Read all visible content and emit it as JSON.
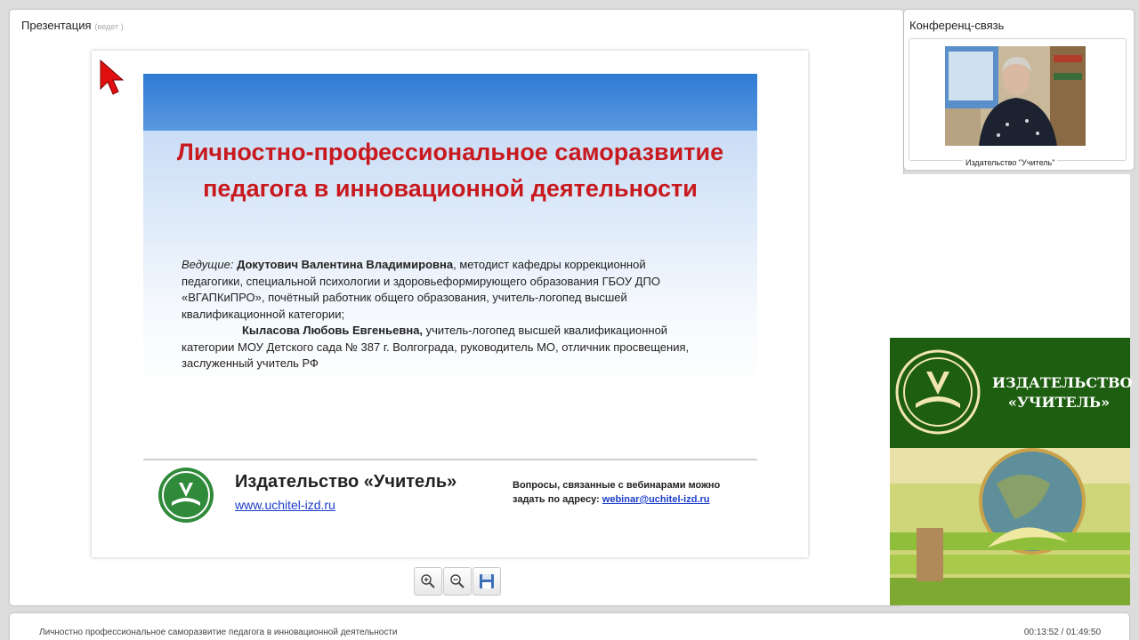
{
  "presentation_panel": {
    "title": "Презентация",
    "subtitle": "(ведет )"
  },
  "slide": {
    "title": "Личностно-профессиональное саморазвитие педагога в инновационной деятельности",
    "leads_label": "Ведущие:",
    "lead1_name": "Докутович Валентина Владимировна",
    "lead1_desc": ", методист кафедры коррекционной педагогики, специальной психологии и здоровьеформирующего образования ГБОУ ДПО «ВГАПКиПРО», почётный работник общего образования, учитель-логопед высшей квалификационной категории;",
    "lead2_name": "Кыласова Любовь Евгеньевна,",
    "lead2_desc": " учитель-логопед высшей квалификационной категории МОУ Детского сада № 387 г. Волгограда, руководитель МО, отличник просвещения, заслуженный учитель РФ",
    "publisher_name": "Издательство «Учитель»",
    "publisher_url": "www.uchitel-izd.ru",
    "questions_text": "Вопросы, связанные с вебинарами можно",
    "questions_text2": "задать по адресу: ",
    "questions_email": "webinar@uchitel-izd.ru"
  },
  "toolbar": {
    "zoom_in_icon": "zoom-in-icon",
    "zoom_out_icon": "zoom-out-icon",
    "save_icon": "save-icon"
  },
  "video_panel": {
    "title": "Конференц-связь",
    "participant_label": "Издательство \"Учитель\""
  },
  "ad_banner": {
    "line1": "ИЗДАТЕЛЬСТВО",
    "line2": "«УЧИТЕЛЬ»"
  },
  "bottom_bar": {
    "webinar_title": "Личностно профессиональное саморазвитие педагога в инновационной деятельности",
    "time_display": "00:13:52 / 01:49:50"
  },
  "colors": {
    "slide_title": "#c8191e",
    "slide_header": "#2f7bd4",
    "ad_green": "#1e5e10",
    "link": "#1a3cc8"
  }
}
